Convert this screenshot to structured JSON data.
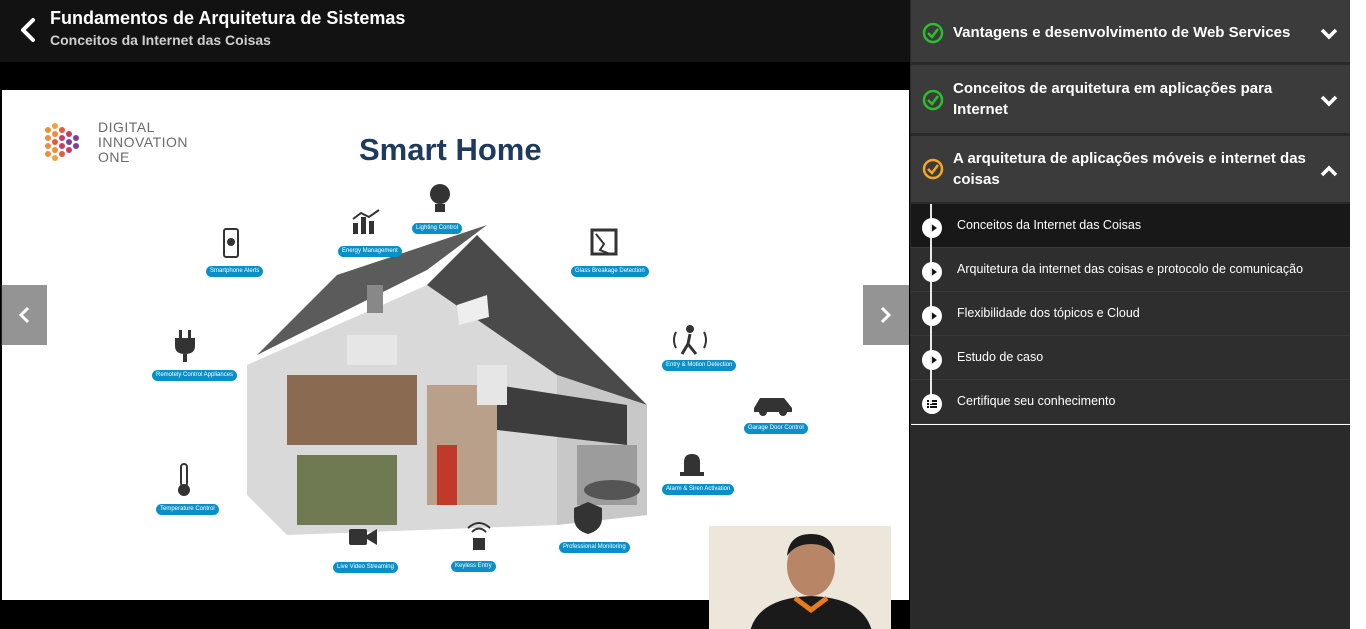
{
  "header": {
    "course_title": "Fundamentos de Arquitetura de Sistemas",
    "lesson_title": "Conceitos da Internet das Coisas"
  },
  "slide": {
    "logo_lines": [
      "DIGITAL",
      "INNOVATION",
      "ONE"
    ],
    "title": "Smart Home",
    "labels": {
      "smartphone": "Smartphone Alerts",
      "energy": "Energy Management",
      "lighting": "Lighting Control",
      "glass": "Glass Breakage Detection",
      "remote": "Remotely Control Appliances",
      "motion": "Entry & Motion Detection",
      "garage": "Garage Door Control",
      "alarm": "Alarm & Siren Activation",
      "temperature": "Temperature Control",
      "video": "Live Video Streaming",
      "keyless": "Keyless Entry",
      "monitoring": "Professional Monitoring"
    }
  },
  "sidebar": {
    "sections": [
      {
        "title": "Vantagens e desenvolvimento de Web Services",
        "status": "complete",
        "expanded": false
      },
      {
        "title": "Conceitos de arquitetura em aplicações para Internet",
        "status": "complete",
        "expanded": false
      },
      {
        "title": "A arquitetura de aplicações móveis e internet das coisas",
        "status": "in-progress",
        "expanded": true
      }
    ],
    "lessons": [
      {
        "label": "Conceitos da Internet das Coisas",
        "type": "video",
        "active": true
      },
      {
        "label": "Arquitetura da internet das coisas e protocolo de comunicação",
        "type": "video",
        "active": false
      },
      {
        "label": "Flexibilidade dos tópicos e Cloud",
        "type": "video",
        "active": false
      },
      {
        "label": "Estudo de caso",
        "type": "video",
        "active": false
      },
      {
        "label": "Certifique seu conhecimento",
        "type": "quiz",
        "active": false
      }
    ]
  },
  "colors": {
    "complete": "#2dbe2d",
    "in_progress": "#f5a623",
    "pill": "#0b8fc9",
    "slide_title": "#1e3a5f"
  },
  "icons": {
    "back": "chevron-left-icon",
    "prev": "chevron-left-icon",
    "next": "chevron-right-icon",
    "collapsed": "chevron-down-icon",
    "expanded": "chevron-up-icon",
    "video_lesson": "play-circle-icon",
    "quiz_lesson": "list-circle-icon"
  }
}
